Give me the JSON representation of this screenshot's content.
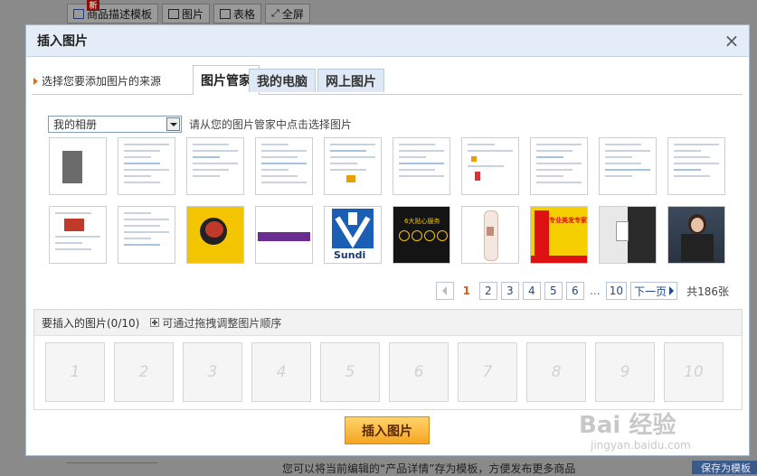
{
  "background": {
    "toolbar": [
      "商品描述模板",
      "图片",
      "表格",
      "全屏"
    ],
    "new_badge": "新",
    "bottom_text": "您可以将当前编辑的“产品详情”存为模板，方便发布更多商品",
    "bottom_right": "保存为模板"
  },
  "dialog": {
    "title": "插入图片",
    "close": "×",
    "source_label": "选择您要添加图片的来源",
    "tabs": [
      "图片管家",
      "我的电脑",
      "网上图片"
    ],
    "album_select": "我的相册",
    "album_hint": "请从您的图片管家中点击选择图片",
    "thumbnails_row2": {
      "sundi_text": "Sundi",
      "banner_text": "6大贴心服务",
      "promo_text": "专业美发专家"
    },
    "pagination": {
      "pages": [
        "1",
        "2",
        "3",
        "4",
        "5",
        "6"
      ],
      "ellipsis": "...",
      "last": "10",
      "next": "下一页",
      "current": "1",
      "total": "共186张"
    },
    "insert_panel": {
      "label": "要插入的图片(0/10)",
      "hint": "可通过拖拽调整图片顺序",
      "slots": [
        "1",
        "2",
        "3",
        "4",
        "5",
        "6",
        "7",
        "8",
        "9",
        "10"
      ]
    },
    "insert_button": "插入图片"
  },
  "watermark": {
    "text": "Bai 经验",
    "sub": "jingyan.baidu.com"
  }
}
